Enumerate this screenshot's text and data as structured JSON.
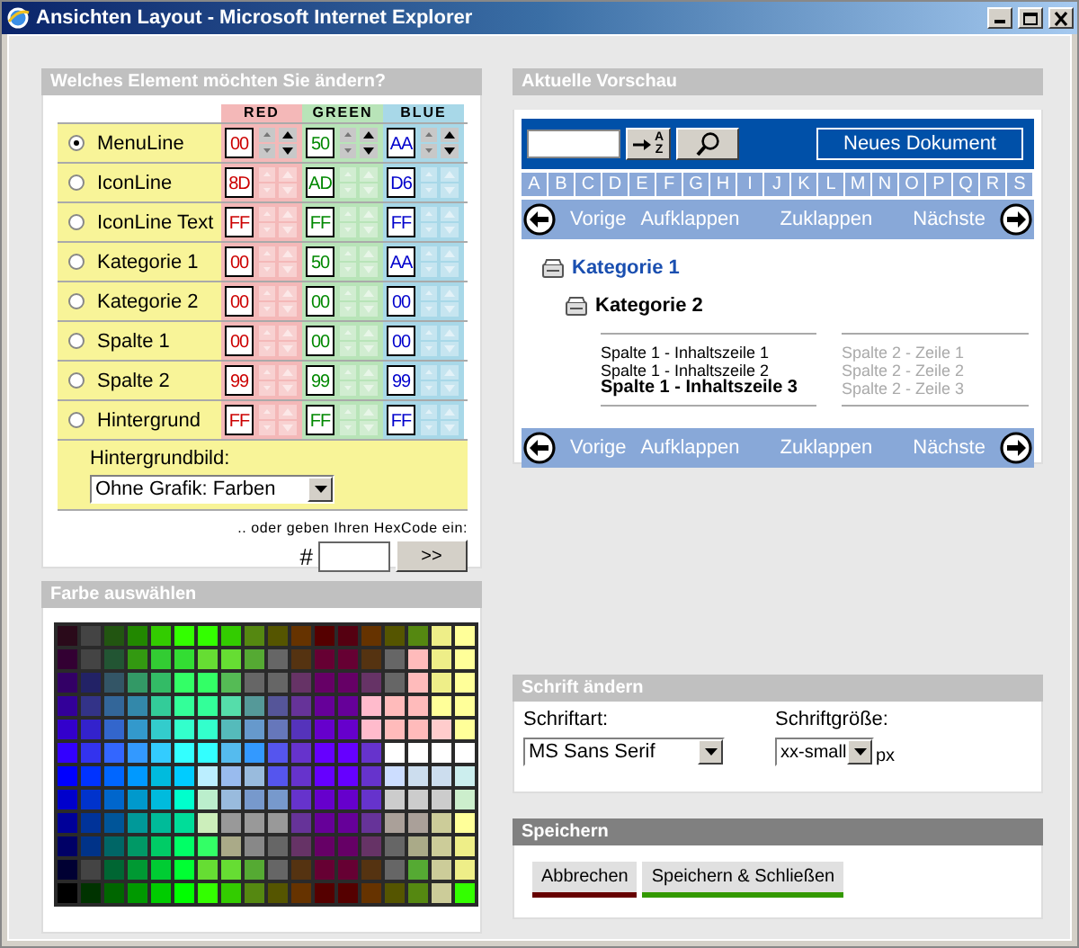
{
  "window": {
    "title": "Ansichten Layout - Microsoft Internet Explorer"
  },
  "element_panel": {
    "title": "Welches Element möchten Sie ändern?",
    "columns": [
      {
        "label": "RED",
        "kind": "red"
      },
      {
        "label": "GREEN",
        "kind": "green"
      },
      {
        "label": "BLUE",
        "kind": "blue"
      }
    ],
    "rows": [
      {
        "label": "MenuLine",
        "selected": true,
        "values": [
          "00",
          "50",
          "AA"
        ]
      },
      {
        "label": "IconLine",
        "selected": false,
        "values": [
          "8D",
          "AD",
          "D6"
        ]
      },
      {
        "label": "IconLine Text",
        "selected": false,
        "values": [
          "FF",
          "FF",
          "FF"
        ]
      },
      {
        "label": "Kategorie 1",
        "selected": false,
        "values": [
          "00",
          "50",
          "AA"
        ]
      },
      {
        "label": "Kategorie 2",
        "selected": false,
        "values": [
          "00",
          "00",
          "00"
        ]
      },
      {
        "label": "Spalte 1",
        "selected": false,
        "values": [
          "00",
          "00",
          "00"
        ]
      },
      {
        "label": "Spalte 2",
        "selected": false,
        "values": [
          "99",
          "99",
          "99"
        ]
      },
      {
        "label": "Hintergrund",
        "selected": false,
        "values": [
          "FF",
          "FF",
          "FF"
        ]
      }
    ],
    "background_label": "Hintergrundbild:",
    "background_select": {
      "value": "Ohne Grafik: Farben"
    },
    "hex_hint": ".. oder geben Ihren HexCode ein:",
    "hash": "#",
    "hex_button": ">>"
  },
  "palette_panel": {
    "title": "Farbe auswählen",
    "rows": [
      [
        {
          "color": "#2a0a1a"
        },
        {
          "color": "#444444"
        },
        {
          "color": "#225511"
        },
        {
          "color": "#228800"
        },
        {
          "color": "#33cc00"
        },
        {
          "color": "#33ff00"
        },
        {
          "color": "#33ff00"
        },
        {
          "color": "#33cc00"
        },
        {
          "color": "#558811"
        },
        {
          "color": "#555500"
        },
        {
          "color": "#663300"
        },
        {
          "color": "#550000"
        },
        {
          "color": "#550011"
        },
        {
          "color": "#663300"
        },
        {
          "color": "#555500"
        },
        {
          "color": "#558811"
        },
        {
          "color": "#eeee88"
        },
        {
          "color": "#ffff99"
        }
      ],
      [
        {
          "color": "#330033"
        },
        {
          "color": "#444444"
        },
        {
          "color": "#225533"
        },
        {
          "color": "#339911"
        },
        {
          "color": "#33cc33"
        },
        {
          "color": "#33dd33"
        },
        {
          "color": "#66dd33"
        },
        {
          "color": "#66dd33"
        },
        {
          "color": "#55aa33"
        },
        {
          "color": "#666666"
        },
        {
          "color": "#553311"
        },
        {
          "color": "#660033"
        },
        {
          "color": "#660033"
        },
        {
          "color": "#553311"
        },
        {
          "color": "#666666"
        },
        {
          "color": "#ffbbbb"
        },
        {
          "color": "#eeee88"
        },
        {
          "color": "#ffff99"
        }
      ],
      [
        {
          "color": "#330066"
        },
        {
          "color": "#222266"
        },
        {
          "color": "#335566"
        },
        {
          "color": "#339966"
        },
        {
          "color": "#33bb66"
        },
        {
          "color": "#33ff66"
        },
        {
          "color": "#33ff66"
        },
        {
          "color": "#55bb55"
        },
        {
          "color": "#666666"
        },
        {
          "color": "#666666"
        },
        {
          "color": "#663366"
        },
        {
          "color": "#660066"
        },
        {
          "color": "#660066"
        },
        {
          "color": "#663366"
        },
        {
          "color": "#666666"
        },
        {
          "color": "#ffbbbb"
        },
        {
          "color": "#eeee88"
        },
        {
          "color": "#ffff99"
        }
      ],
      [
        {
          "color": "#330099"
        },
        {
          "color": "#333388"
        },
        {
          "color": "#336699"
        },
        {
          "color": "#3388aa"
        },
        {
          "color": "#33cc99"
        },
        {
          "color": "#33ff99"
        },
        {
          "color": "#33ff99"
        },
        {
          "color": "#55ddaa"
        },
        {
          "color": "#559999"
        },
        {
          "color": "#555599"
        },
        {
          "color": "#663399"
        },
        {
          "color": "#660099"
        },
        {
          "color": "#660099"
        },
        {
          "color": "#ffbbcc"
        },
        {
          "color": "#ffbbbb"
        },
        {
          "color": "#ffbbbb"
        },
        {
          "color": "#ffff99"
        },
        {
          "color": "#ffff99"
        }
      ],
      [
        {
          "color": "#3300cc"
        },
        {
          "color": "#3322cc"
        },
        {
          "color": "#3366cc"
        },
        {
          "color": "#3399cc"
        },
        {
          "color": "#33cccc"
        },
        {
          "color": "#33ffcc"
        },
        {
          "color": "#33ffcc"
        },
        {
          "color": "#55bbbb"
        },
        {
          "color": "#6699cc"
        },
        {
          "color": "#6677bb"
        },
        {
          "color": "#5533bb"
        },
        {
          "color": "#6600cc"
        },
        {
          "color": "#6600cc"
        },
        {
          "color": "#ffbbcc"
        },
        {
          "color": "#ffbbbb"
        },
        {
          "color": "#ffbbbb"
        },
        {
          "color": "#ffcccc"
        },
        {
          "color": "#ffff99"
        }
      ],
      [
        {
          "color": "#3300ff"
        },
        {
          "color": "#3333ee"
        },
        {
          "color": "#3366ff"
        },
        {
          "color": "#3399ff"
        },
        {
          "color": "#33ccff"
        },
        {
          "color": "#33ffff"
        },
        {
          "color": "#33ffff"
        },
        {
          "color": "#55bbee"
        },
        {
          "color": "#3399ff"
        },
        {
          "color": "#5555ee"
        },
        {
          "color": "#6633cc"
        },
        {
          "color": "#6600ff"
        },
        {
          "color": "#6600ff"
        },
        {
          "color": "#6633cc"
        },
        {
          "color": "#ffffff"
        },
        {
          "color": "#ffffff"
        },
        {
          "color": "#ffffff"
        },
        {
          "color": "#ffffff"
        }
      ],
      [
        {
          "color": "#0000ff"
        },
        {
          "color": "#0033ff"
        },
        {
          "color": "#0066ff"
        },
        {
          "color": "#0099ff"
        },
        {
          "color": "#00bbdd"
        },
        {
          "color": "#00ccff"
        },
        {
          "color": "#bbeeff"
        },
        {
          "color": "#99bbee"
        },
        {
          "color": "#99bbdd"
        },
        {
          "color": "#5555ee"
        },
        {
          "color": "#6633cc"
        },
        {
          "color": "#6600ff"
        },
        {
          "color": "#6600ff"
        },
        {
          "color": "#6633cc"
        },
        {
          "color": "#ccddff"
        },
        {
          "color": "#ccddee"
        },
        {
          "color": "#ccddee"
        },
        {
          "color": "#cceeee"
        }
      ],
      [
        {
          "color": "#0000cc"
        },
        {
          "color": "#0033cc"
        },
        {
          "color": "#0066cc"
        },
        {
          "color": "#0099cc"
        },
        {
          "color": "#00bbdd"
        },
        {
          "color": "#00ffcc"
        },
        {
          "color": "#bbeecc"
        },
        {
          "color": "#99bbdd"
        },
        {
          "color": "#7799cc"
        },
        {
          "color": "#7799cc"
        },
        {
          "color": "#6633cc"
        },
        {
          "color": "#6600cc"
        },
        {
          "color": "#6600cc"
        },
        {
          "color": "#6633cc"
        },
        {
          "color": "#cccccc"
        },
        {
          "color": "#cccccc"
        },
        {
          "color": "#cccccc"
        },
        {
          "color": "#cceecc"
        }
      ],
      [
        {
          "color": "#000099"
        },
        {
          "color": "#003399"
        },
        {
          "color": "#005599"
        },
        {
          "color": "#009999"
        },
        {
          "color": "#00bb99"
        },
        {
          "color": "#00dd99"
        },
        {
          "color": "#cceebb"
        },
        {
          "color": "#999999"
        },
        {
          "color": "#999999"
        },
        {
          "color": "#999999"
        },
        {
          "color": "#663399"
        },
        {
          "color": "#660099"
        },
        {
          "color": "#660099"
        },
        {
          "color": "#663399"
        },
        {
          "color": "#aaa099"
        },
        {
          "color": "#aaa099"
        },
        {
          "color": "#cccc99"
        },
        {
          "color": "#ffff99"
        }
      ],
      [
        {
          "color": "#000066"
        },
        {
          "color": "#003388"
        },
        {
          "color": "#006666"
        },
        {
          "color": "#009966"
        },
        {
          "color": "#00cc66"
        },
        {
          "color": "#00ff66"
        },
        {
          "color": "#33ff66"
        },
        {
          "color": "#aaaa88"
        },
        {
          "color": "#888888"
        },
        {
          "color": "#666666"
        },
        {
          "color": "#663366"
        },
        {
          "color": "#660066"
        },
        {
          "color": "#660066"
        },
        {
          "color": "#663366"
        },
        {
          "color": "#666666"
        },
        {
          "color": "#aaaa88"
        },
        {
          "color": "#cccc99"
        },
        {
          "color": "#eeee88"
        }
      ],
      [
        {
          "color": "#000033"
        },
        {
          "color": "#444444"
        },
        {
          "color": "#006633"
        },
        {
          "color": "#009933"
        },
        {
          "color": "#00cc33"
        },
        {
          "color": "#00ff33"
        },
        {
          "color": "#66dd33"
        },
        {
          "color": "#66dd33"
        },
        {
          "color": "#55aa33"
        },
        {
          "color": "#666666"
        },
        {
          "color": "#553311"
        },
        {
          "color": "#660033"
        },
        {
          "color": "#660033"
        },
        {
          "color": "#553311"
        },
        {
          "color": "#666666"
        },
        {
          "color": "#55aa33"
        },
        {
          "color": "#cccc99"
        },
        {
          "color": "#eeee88"
        }
      ],
      [
        {
          "color": "#000000"
        },
        {
          "color": "#003300"
        },
        {
          "color": "#006600"
        },
        {
          "color": "#009900"
        },
        {
          "color": "#00cc00"
        },
        {
          "color": "#00ff00"
        },
        {
          "color": "#33ff00"
        },
        {
          "color": "#33cc00"
        },
        {
          "color": "#558811"
        },
        {
          "color": "#555500"
        },
        {
          "color": "#663300"
        },
        {
          "color": "#550000"
        },
        {
          "color": "#550000"
        },
        {
          "color": "#663300"
        },
        {
          "color": "#555500"
        },
        {
          "color": "#558811"
        },
        {
          "color": "#cccc99"
        },
        {
          "color": "#33ff00"
        }
      ]
    ]
  },
  "preview_panel": {
    "title": "Aktuelle Vorschau",
    "sort_letters": [
      "A",
      "Z"
    ],
    "new_button": "Neues Dokument",
    "letters": [
      "A",
      "B",
      "C",
      "D",
      "E",
      "F",
      "G",
      "H",
      "I",
      "J",
      "K",
      "L",
      "M",
      "N",
      "O",
      "P",
      "Q",
      "R",
      "S"
    ],
    "nav_top": [
      "Vorige",
      "Aufklappen",
      "Zuklappen",
      "Nächste"
    ],
    "category_1": "Kategorie 1",
    "category_2": "Kategorie 2",
    "column_1": [
      {
        "text": "Spalte 1 - Inhaltszeile 1",
        "bold": false
      },
      {
        "text": "Spalte 1 - Inhaltszeile 2",
        "bold": false
      },
      {
        "text": "Spalte 1 - Inhaltszeile 3",
        "bold": true
      }
    ],
    "column_2": [
      "Spalte 2 - Zeile 1",
      "Spalte 2 - Zeile 2",
      "Spalte 2 - Zeile 3"
    ],
    "nav_bottom": [
      "Vorige",
      "Aufklappen",
      "Zuklappen",
      "Nächste"
    ]
  },
  "font_panel": {
    "title": "Schrift ändern",
    "font_label": "Schriftart:",
    "font_value": "MS Sans Serif",
    "size_label": "Schriftgröße:",
    "size_value": "xx-small",
    "unit": "px"
  },
  "save_panel": {
    "title": "Speichern",
    "buttons": [
      {
        "label": "Abbrechen",
        "color": "#660000"
      },
      {
        "label": "Speichern & Schließen",
        "color": "#339900"
      }
    ]
  }
}
